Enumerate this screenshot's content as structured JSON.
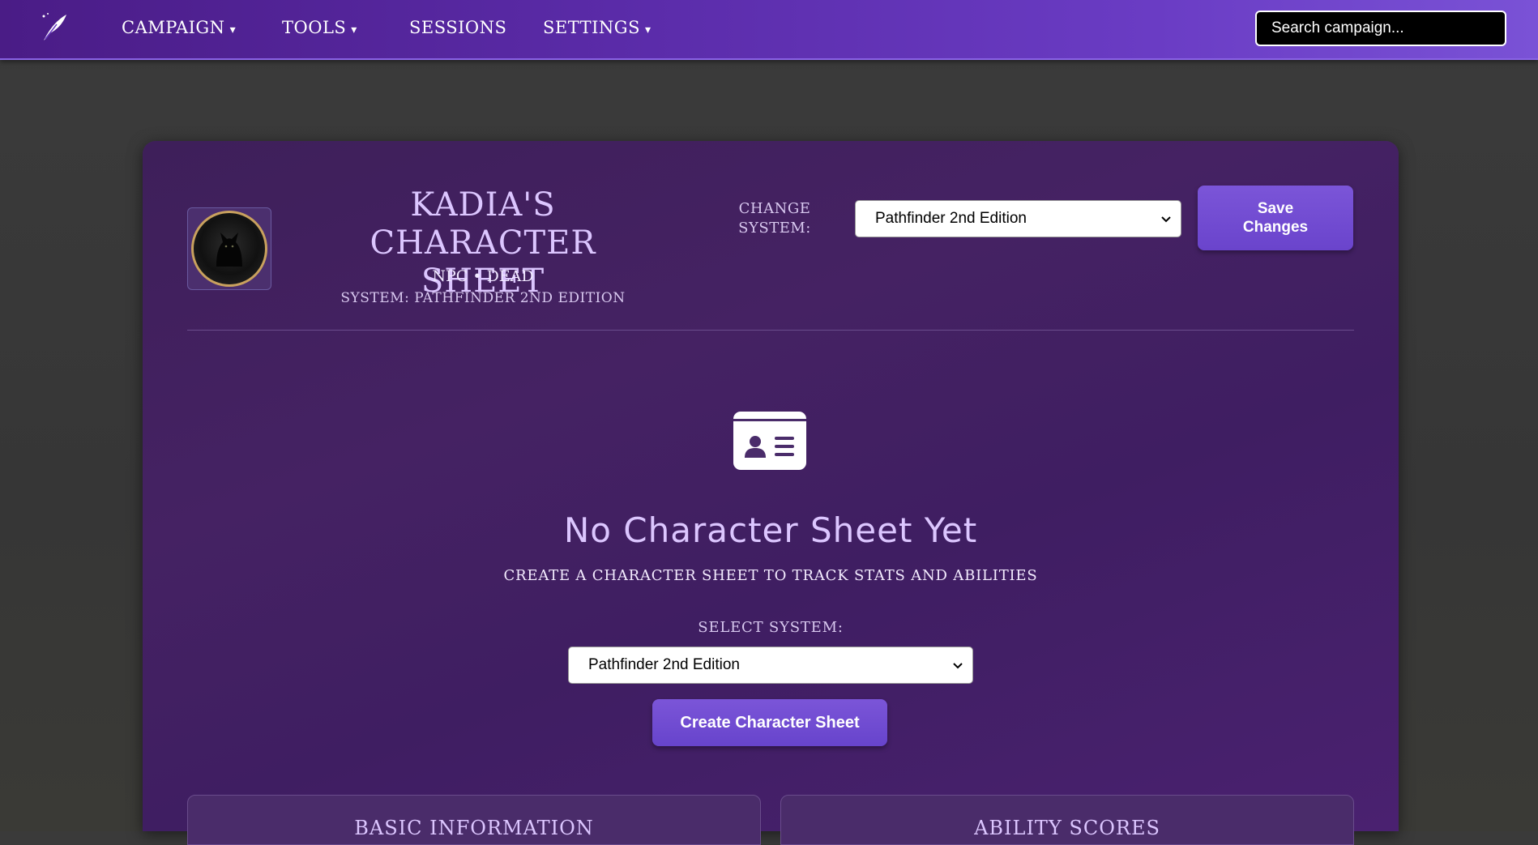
{
  "nav": {
    "logo_icon": "quill-feather-icon",
    "items": [
      {
        "label": "CAMPAIGN",
        "has_dropdown": true
      },
      {
        "label": "TOOLS",
        "has_dropdown": true
      },
      {
        "label": "SESSIONS",
        "has_dropdown": false
      },
      {
        "label": "SETTINGS",
        "has_dropdown": true
      }
    ],
    "caret": "▾",
    "search_placeholder": "Search campaign..."
  },
  "header": {
    "title": "KADIA'S CHARACTER SHEET",
    "subtitle": "NPC • DEAD",
    "system_line": "SYSTEM: PATHFINDER 2ND EDITION",
    "change_system_label": "CHANGE SYSTEM:",
    "change_system_value": "Pathfinder 2nd Edition",
    "save_button": "Save Changes"
  },
  "empty_state": {
    "icon": "id-card-icon",
    "title": "No Character Sheet Yet",
    "description": "CREATE A CHARACTER SHEET TO TRACK STATS AND ABILITIES",
    "select_label": "SELECT SYSTEM:",
    "select_value": "Pathfinder 2nd Edition",
    "create_button": "Create Character Sheet"
  },
  "sections": [
    {
      "label": "BASIC INFORMATION"
    },
    {
      "label": "ABILITY SCORES"
    }
  ],
  "colors": {
    "nav_gradient_start": "#4a1c86",
    "nav_gradient_end": "#7a52d6",
    "panel": "#452263",
    "accent_button": "#7b55d8",
    "title_lavender": "#dcc6ff",
    "avatar_ring": "#c9a15e"
  }
}
